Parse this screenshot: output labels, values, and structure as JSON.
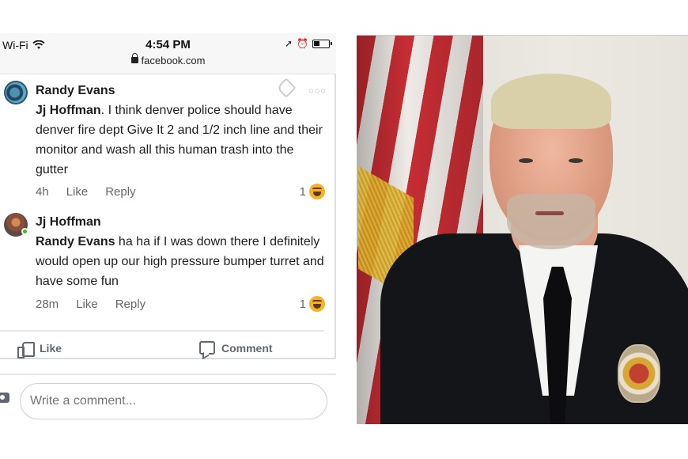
{
  "status_bar": {
    "wifi_label": "Wi-Fi",
    "time": "4:54 PM",
    "url": "facebook.com"
  },
  "comments": [
    {
      "author": "Randy Evans",
      "mention": "Jj Hoffman",
      "text": ". I think denver police should have denver fire dept Give It 2 and 1/2 inch line and their monitor and wash all this human trash into the gutter",
      "time": "4h",
      "like_label": "Like",
      "reply_label": "Reply",
      "reaction_count": "1",
      "reaction_icon": "haha-emoji-icon"
    },
    {
      "author": "Jj Hoffman",
      "mention": "Randy Evans",
      "text": " ha ha if I was down there I definitely would open up our high pressure bumper turret and have some fun",
      "time": "28m",
      "like_label": "Like",
      "reply_label": "Reply",
      "reaction_count": "1",
      "reaction_icon": "haha-emoji-icon"
    }
  ],
  "actions": {
    "like_label": "Like",
    "comment_label": "Comment"
  },
  "write_comment": {
    "placeholder": "Write a comment..."
  },
  "colors": {
    "reaction_yellow": "#f7b125",
    "online_green": "#42b72a",
    "muted_text": "#65676b"
  }
}
